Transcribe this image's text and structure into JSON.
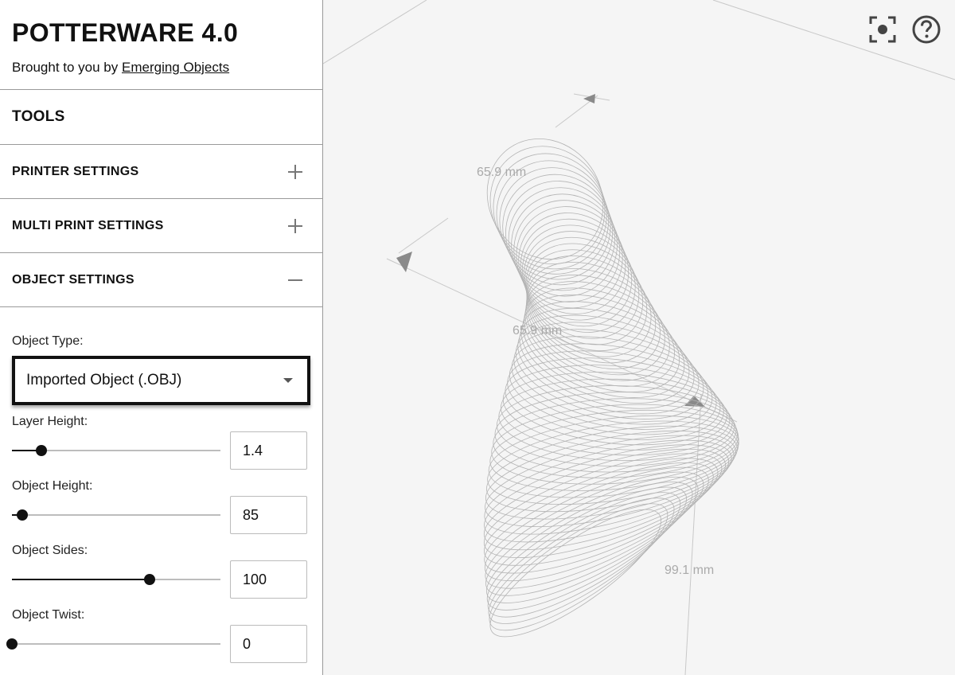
{
  "app": {
    "title": "POTTERWARE 4.0",
    "subtitle_prefix": "Brought to you by",
    "subtitle_link": "Emerging Objects"
  },
  "sections": {
    "tools": "TOOLS",
    "printer_settings": "PRINTER SETTINGS",
    "multi_print_settings": "MULTI PRINT SETTINGS",
    "object_settings": "OBJECT SETTINGS"
  },
  "object_settings": {
    "object_type_label": "Object Type:",
    "object_type_value": "Imported Object (.OBJ)",
    "fields": [
      {
        "label": "Layer Height:",
        "value": "1.4",
        "slider_fraction": 0.14
      },
      {
        "label": "Object Height:",
        "value": "85",
        "slider_fraction": 0.05
      },
      {
        "label": "Object Sides:",
        "value": "100",
        "slider_fraction": 0.66
      },
      {
        "label": "Object Twist:",
        "value": "0",
        "slider_fraction": 0.0
      }
    ]
  },
  "viewport": {
    "dimension_labels": [
      "65.9 mm",
      "65.9 mm",
      "99.1 mm"
    ],
    "icons": [
      "focus-icon",
      "help-icon"
    ]
  }
}
